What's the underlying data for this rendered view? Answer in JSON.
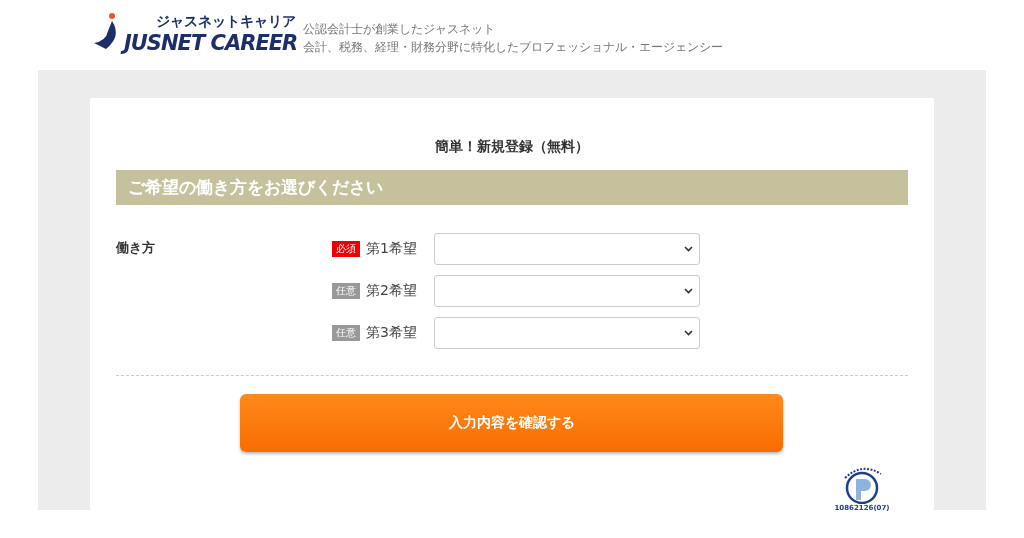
{
  "header": {
    "logo_kana": "ジャスネットキャリア",
    "logo_latin": "JUSNET CAREER",
    "tagline_1": "公認会計士が創業したジャスネット",
    "tagline_2": "会計、税務、経理・財務分野に特化したプロフェッショナル・エージェンシー"
  },
  "form": {
    "title": "簡単！新規登録（無料）",
    "section": "ご希望の働き方をお選びください",
    "field_label": "働き方",
    "choices": [
      {
        "kind": "required",
        "badge": "必須",
        "label": "第1希望"
      },
      {
        "kind": "optional",
        "badge": "任意",
        "label": "第2希望"
      },
      {
        "kind": "optional",
        "badge": "任意",
        "label": "第3希望"
      }
    ],
    "submit": "入力内容を確認する",
    "privacy_number": "10862126(07)"
  }
}
